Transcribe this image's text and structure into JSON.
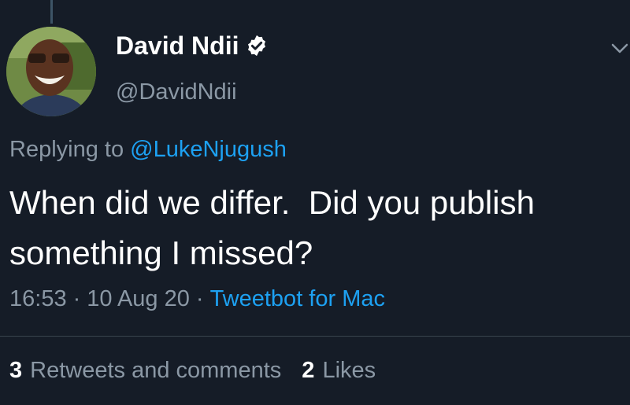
{
  "author": {
    "display_name": "David Ndii",
    "handle": "@DavidNdii",
    "verified": true
  },
  "reply": {
    "prefix": "Replying to",
    "mention": "@LukeNjugush"
  },
  "tweet": {
    "line1": "When did we differ.  Did you publish",
    "line2": "something I missed?"
  },
  "meta": {
    "time": "16:53",
    "separator1": "·",
    "date": "10 Aug 20",
    "separator2": "·",
    "source": "Tweetbot for Mac"
  },
  "stats": {
    "retweets_count": "3",
    "retweets_label": "Retweets and comments",
    "likes_count": "2",
    "likes_label": "Likes"
  },
  "colors": {
    "background": "#151c27",
    "accent": "#1da1f2",
    "muted": "#8b98a5",
    "text": "#ffffff"
  }
}
